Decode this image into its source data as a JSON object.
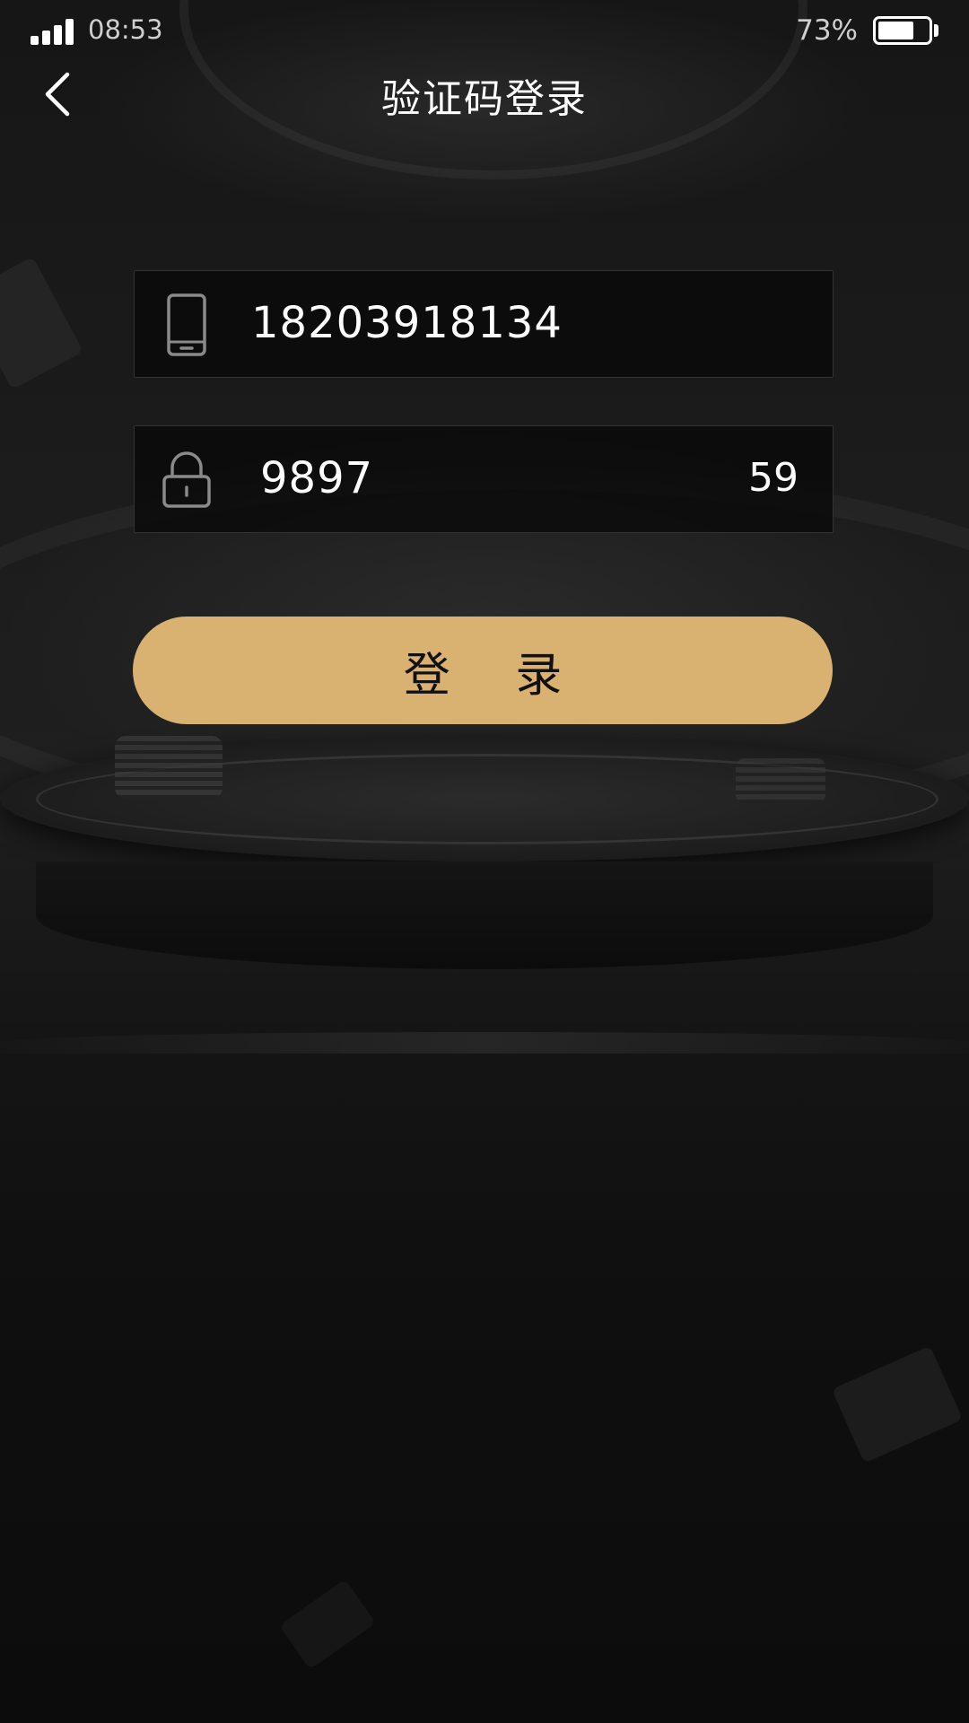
{
  "status_bar": {
    "time": "08:53",
    "battery_percent_label": "73%",
    "battery_level": 0.73
  },
  "nav": {
    "title": "验证码登录",
    "back_icon": "chevron-left-icon"
  },
  "form": {
    "phone": {
      "icon": "phone-icon",
      "value": "18203918134"
    },
    "code": {
      "icon": "lock-icon",
      "value": "9897",
      "countdown": "59"
    },
    "login_label": "登 录"
  },
  "colors": {
    "accent": "#d9b272",
    "background": "#121212",
    "field_background": "#0a0a0a",
    "text": "#ffffff"
  }
}
